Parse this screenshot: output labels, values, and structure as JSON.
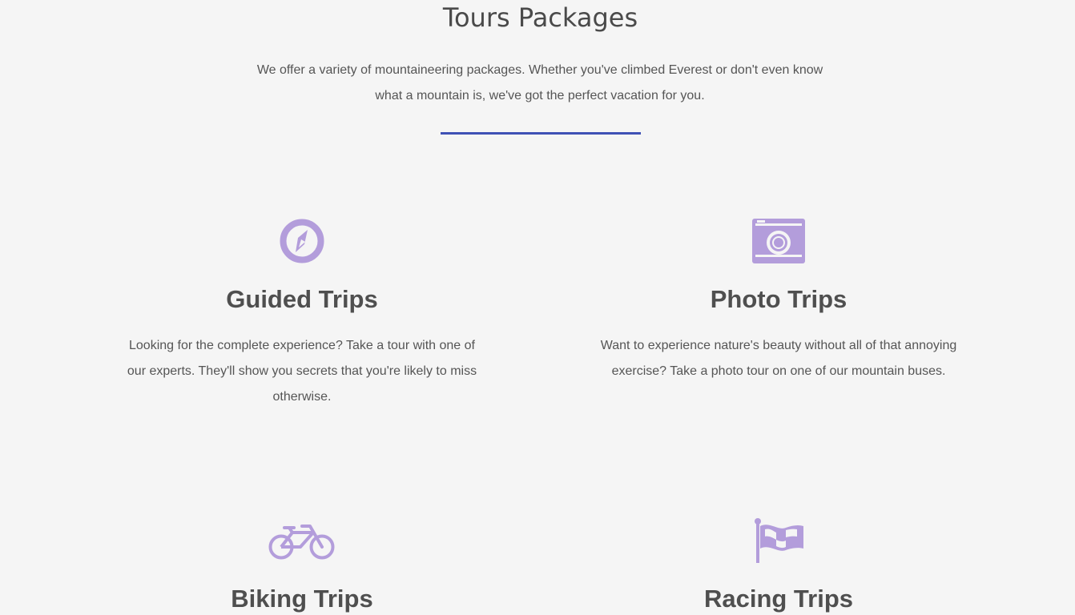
{
  "section": {
    "title": "Tours Packages",
    "intro": "We offer a variety of mountaineering packages. Whether you've climbed Everest or don't even know what a mountain is, we've got the perfect vacation for you."
  },
  "colors": {
    "icon": "#b39ddb",
    "divider": "#3f51b5",
    "heading": "#4f4f4f",
    "text": "#555555",
    "background": "#f5f5f5"
  },
  "packages": [
    {
      "icon": "compass-icon",
      "title": "Guided Trips",
      "description": "Looking for the complete experience? Take a tour with one of our experts. They'll show you secrets that you're likely to miss otherwise."
    },
    {
      "icon": "camera-icon",
      "title": "Photo Trips",
      "description": "Want to experience nature's beauty without all of that annoying exercise? Take a photo tour on one of our mountain buses."
    },
    {
      "icon": "bicycle-icon",
      "title": "Biking Trips"
    },
    {
      "icon": "checkered-flag-icon",
      "title": "Racing Trips"
    }
  ]
}
